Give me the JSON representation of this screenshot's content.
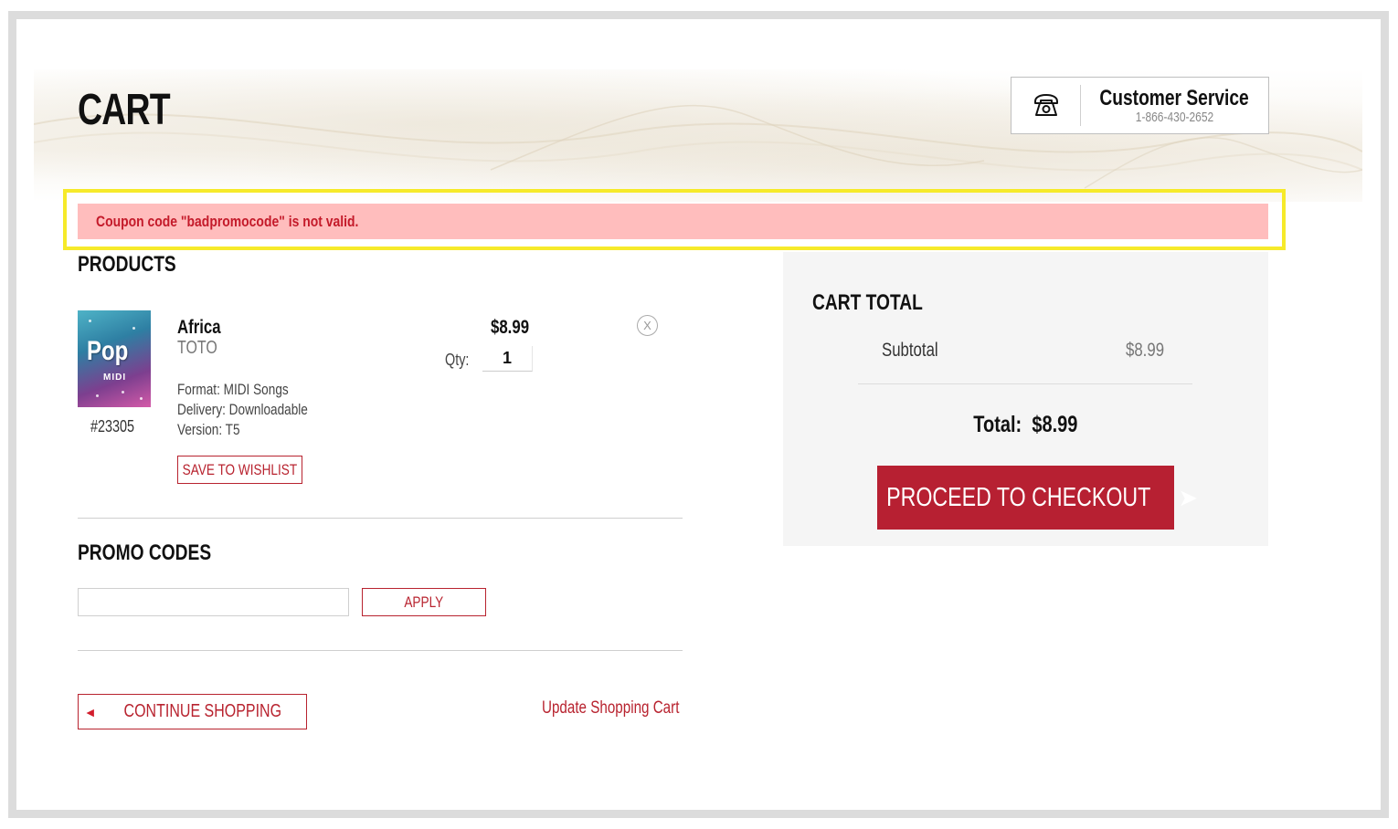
{
  "header": {
    "title": "CART",
    "customer_service": {
      "title": "Customer Service",
      "phone": "1-866-430-2652",
      "icon": "phone-icon"
    }
  },
  "alert": {
    "message": "Coupon code \"badpromocode\" is not valid.",
    "color": "#c41a2a",
    "background": "#ffbdbd",
    "highlight_color": "#f6ea2a"
  },
  "products": {
    "heading": "PRODUCTS",
    "items": [
      {
        "cover_text": "Pop",
        "cover_subtext": "MIDI",
        "name": "Africa",
        "artist": "TOTO",
        "sku": "#23305",
        "format": "Format: MIDI Songs",
        "delivery": "Delivery: Downloadable",
        "version": "Version: T5",
        "price": "$8.99",
        "qty_label": "Qty:",
        "qty": "1",
        "wishlist_label": "SAVE TO WISHLIST",
        "remove_label": "X"
      }
    ]
  },
  "promo": {
    "heading": "PROMO CODES",
    "input_value": "",
    "apply_label": "APPLY"
  },
  "footer_actions": {
    "continue_label": "CONTINUE SHOPPING",
    "continue_arrow": "◄",
    "update_label": "Update Shopping Cart"
  },
  "cart_total": {
    "heading": "CART TOTAL",
    "subtotal_label": "Subtotal",
    "subtotal_value": "$8.99",
    "total_label": "Total:",
    "total_value": "$8.99",
    "checkout_label": "PROCEED TO CHECKOUT",
    "checkout_arrow": "➤"
  },
  "colors": {
    "accent": "#b72032",
    "border": "#cfcfcf",
    "panel": "#f5f5f5"
  }
}
